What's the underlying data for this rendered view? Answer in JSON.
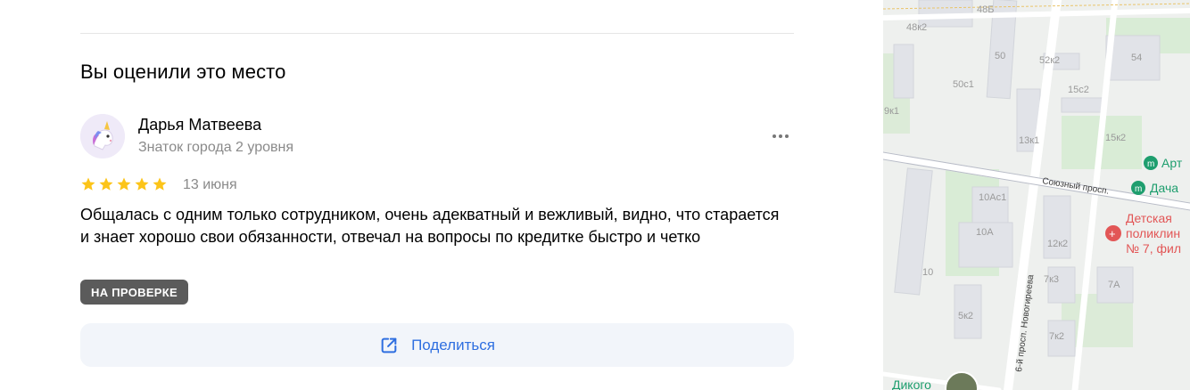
{
  "section": {
    "title": "Вы оценили это место"
  },
  "review": {
    "author_name": "Дарья Матвеева",
    "author_status": "Знаток города 2 уровня",
    "rating": 5,
    "rating_max": 5,
    "date": "13 июня",
    "text": "Общалась с одним только сотрудником, очень адекватный и вежливый, видно, что старается и знает хорошо свои обязанности, отвечал на вопросы по кредитке быстро и четко",
    "status_badge": "НА ПРОВЕРКЕ"
  },
  "actions": {
    "share_label": "Поделиться"
  },
  "icons": {
    "avatar": "unicorn-avatar-icon",
    "more": "more-dots-icon",
    "star": "star-icon",
    "share": "share-icon"
  },
  "colors": {
    "star": "#fcc419",
    "badge_bg": "#5b5b5b",
    "share_text": "#2f6fe0",
    "share_bg": "#f2f5fa",
    "map_poi_green": "#1e9e6e",
    "map_poi_red": "#e25656"
  },
  "map": {
    "building_labels": [
      "48Б",
      "48к2",
      "50",
      "52к2",
      "54",
      "50с1",
      "15с2",
      "9к1",
      "13к1",
      "15к2",
      "10Ас1",
      "10А",
      "10",
      "12к2",
      "7к3",
      "7А",
      "5к2",
      "7к2"
    ],
    "streets": [
      "Союзный просп.",
      "6-й просп. Новогиреева"
    ],
    "pois": [
      "Арт",
      "Дача",
      "Детская",
      "поликлин",
      "№ 7, фил",
      "Дикого"
    ]
  }
}
